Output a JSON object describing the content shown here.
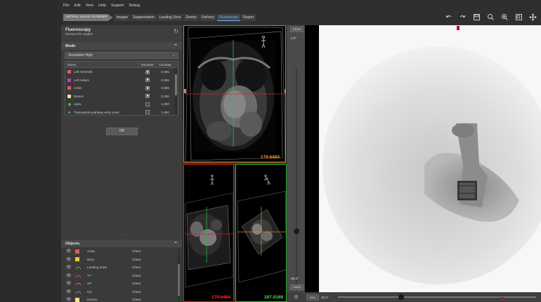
{
  "menu": [
    "File",
    "Edit",
    "View",
    "Help",
    "Support",
    "Debug"
  ],
  "workflow": {
    "app_title": "MITRAL VALVE PLANNER",
    "tabs": [
      "Images",
      "Segmentation",
      "Landing Zone",
      "Device",
      "Delivery",
      "Fluoroscopy",
      "Report"
    ],
    "active_tab": "Fluoroscopy"
  },
  "toolbar_icons": [
    "undo-icon",
    "redo-icon",
    "save-icon",
    "zoom-icon",
    "zoom-in-icon",
    "zoom-fit-icon",
    "move-icon"
  ],
  "panel": {
    "title": "Fluoroscopy",
    "subtitle": "Review the angles",
    "mode_section": "Mode",
    "mode_value": "Simulation High",
    "table_headers": {
      "name": "Name",
      "simulate": "Simulate",
      "contrast": "Contrast"
    },
    "rows": [
      {
        "name": "Left Ventricle",
        "color": "#e2585f",
        "kind": "swatch",
        "checked": true,
        "contrast": "0,065"
      },
      {
        "name": "Left Atrium",
        "color": "#c238c8",
        "kind": "swatch",
        "checked": true,
        "contrast": "0,065"
      },
      {
        "name": "Aorta",
        "color": "#e2585f",
        "kind": "swatch",
        "checked": true,
        "contrast": "0,065"
      },
      {
        "name": "Device",
        "color": "#f4e38a",
        "kind": "swatch",
        "checked": true,
        "contrast": "0,250"
      },
      {
        "name": "Apex",
        "color": "#35c24a",
        "kind": "dot",
        "checked": false,
        "contrast": "1,000"
      },
      {
        "name": "Transapical pathway entry point",
        "color": "#35c24a",
        "kind": "dots",
        "checked": false,
        "contrast": "1,000"
      }
    ],
    "ok_label": "OK",
    "splitter": "....."
  },
  "objects": {
    "title": "Objects",
    "items": [
      {
        "name": "Aorta",
        "region": "Chest",
        "color": "#e2585f",
        "kind": "swatch"
      },
      {
        "name": "MAC",
        "region": "Chest",
        "color": "#f2c434",
        "kind": "swatch"
      },
      {
        "name": "Landing Zone",
        "region": "Chest",
        "color": "#3cbf45",
        "kind": "line"
      },
      {
        "name": "TT",
        "region": "Chest",
        "color": "#d9534f",
        "kind": "line"
      },
      {
        "name": "AP",
        "region": "Chest",
        "color": "#e06a6a",
        "kind": "line"
      },
      {
        "name": "CC",
        "region": "Chest",
        "color": "#8c8c8c",
        "kind": "line"
      },
      {
        "name": "Device",
        "region": "Chest",
        "color": "#f4e38a",
        "kind": "swatch"
      }
    ]
  },
  "viewports": {
    "top_value": "179.6484",
    "bottom_left_value": "179.6484",
    "bottom_right_value": "167.0169",
    "top_color": "#ff9a1c",
    "bottom_left_color": "#ff2a2a",
    "bottom_right_color": "#52e05a"
  },
  "fluoro": {
    "btn_top": "CRAN",
    "angle_top": "0.0°",
    "angle_bottom": "38.3°",
    "btn_bottom": "CAUD",
    "bottom_btn": "RAO",
    "bottom_angle": "33.0°"
  }
}
